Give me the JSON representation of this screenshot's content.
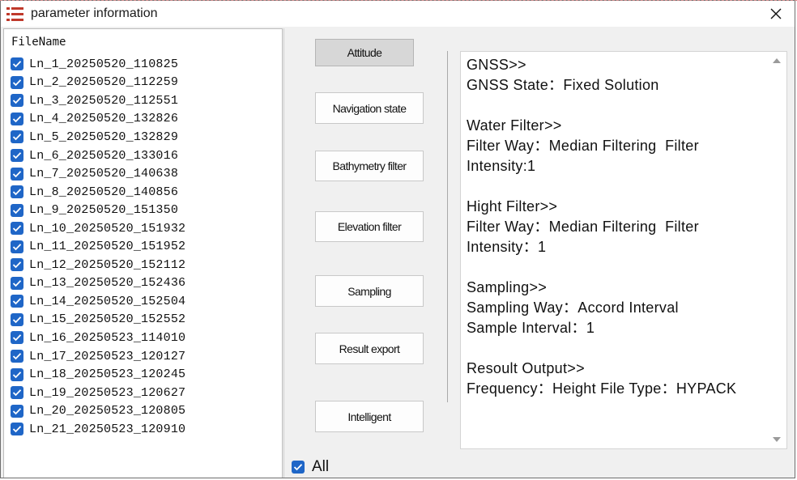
{
  "window": {
    "title": "parameter information"
  },
  "file_list": {
    "header": "FileName",
    "items": [
      {
        "name": "Ln_1_20250520_110825",
        "checked": true
      },
      {
        "name": "Ln_2_20250520_112259",
        "checked": true
      },
      {
        "name": "Ln_3_20250520_112551",
        "checked": true
      },
      {
        "name": "Ln_4_20250520_132826",
        "checked": true
      },
      {
        "name": "Ln_5_20250520_132829",
        "checked": true
      },
      {
        "name": "Ln_6_20250520_133016",
        "checked": true
      },
      {
        "name": "Ln_7_20250520_140638",
        "checked": true
      },
      {
        "name": "Ln_8_20250520_140856",
        "checked": true
      },
      {
        "name": "Ln_9_20250520_151350",
        "checked": true
      },
      {
        "name": "Ln_10_20250520_151932",
        "checked": true
      },
      {
        "name": "Ln_11_20250520_151952",
        "checked": true
      },
      {
        "name": "Ln_12_20250520_152112",
        "checked": true
      },
      {
        "name": "Ln_13_20250520_152436",
        "checked": true
      },
      {
        "name": "Ln_14_20250520_152504",
        "checked": true
      },
      {
        "name": "Ln_15_20250520_152552",
        "checked": true
      },
      {
        "name": "Ln_16_20250523_114010",
        "checked": true
      },
      {
        "name": "Ln_17_20250523_120127",
        "checked": true
      },
      {
        "name": "Ln_18_20250523_120245",
        "checked": true
      },
      {
        "name": "Ln_19_20250523_120627",
        "checked": true
      },
      {
        "name": "Ln_20_20250523_120805",
        "checked": true
      },
      {
        "name": "Ln_21_20250523_120910",
        "checked": true
      }
    ]
  },
  "buttons": {
    "attitude": "Attitude",
    "navigation_state": "Navigation state",
    "bathymetry_filter": "Bathymetry filter",
    "elevation_filter": "Elevation filter",
    "sampling": "Sampling",
    "result_export": "Result export",
    "intelligent": "Intelligent"
  },
  "info": {
    "text": "GNSS>>\nGNSS State：Fixed Solution\n\nWater Filter>>\nFilter Way：Median Filtering  Filter Intensity:1\n\nHight Filter>>\nFilter Way：Median Filtering  Filter Intensity：1\n\nSampling>>\nSampling Way：Accord Interval\nSample Interval：1\n\nResoult Output>>\nFrequency：Height File Type：HYPACK"
  },
  "all_checkbox": {
    "label": "All",
    "checked": true
  },
  "colors": {
    "checkbox": "#1f66c7",
    "app_icon": "#c0392b"
  }
}
